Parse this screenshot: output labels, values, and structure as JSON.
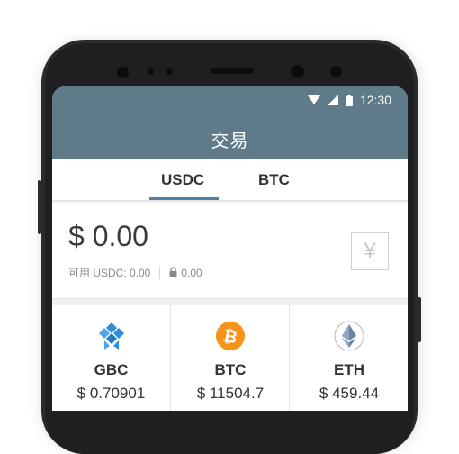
{
  "status_bar": {
    "time": "12:30",
    "icons": [
      "wifi-icon",
      "signal-icon",
      "battery-icon"
    ]
  },
  "header": {
    "title": "交易"
  },
  "tabs": [
    {
      "label": "USDC",
      "active": true
    },
    {
      "label": "BTC",
      "active": false
    }
  ],
  "balance": {
    "amount": "$ 0.00",
    "available": "可用 USDC: 0.00",
    "locked": "0.00",
    "currency_button": "¥"
  },
  "coins": [
    {
      "symbol": "GBC",
      "price": "$ 0.70901",
      "icon": "gbc-logo-icon"
    },
    {
      "symbol": "BTC",
      "price": "$ 11504.7",
      "icon": "bitcoin-icon"
    },
    {
      "symbol": "ETH",
      "price": "$ 459.44",
      "icon": "ethereum-icon"
    }
  ],
  "colors": {
    "header": "#5f7a89",
    "tab_indicator": "#5082a8",
    "bitcoin": "#f7931a",
    "gbc": "#2a8fd8"
  }
}
